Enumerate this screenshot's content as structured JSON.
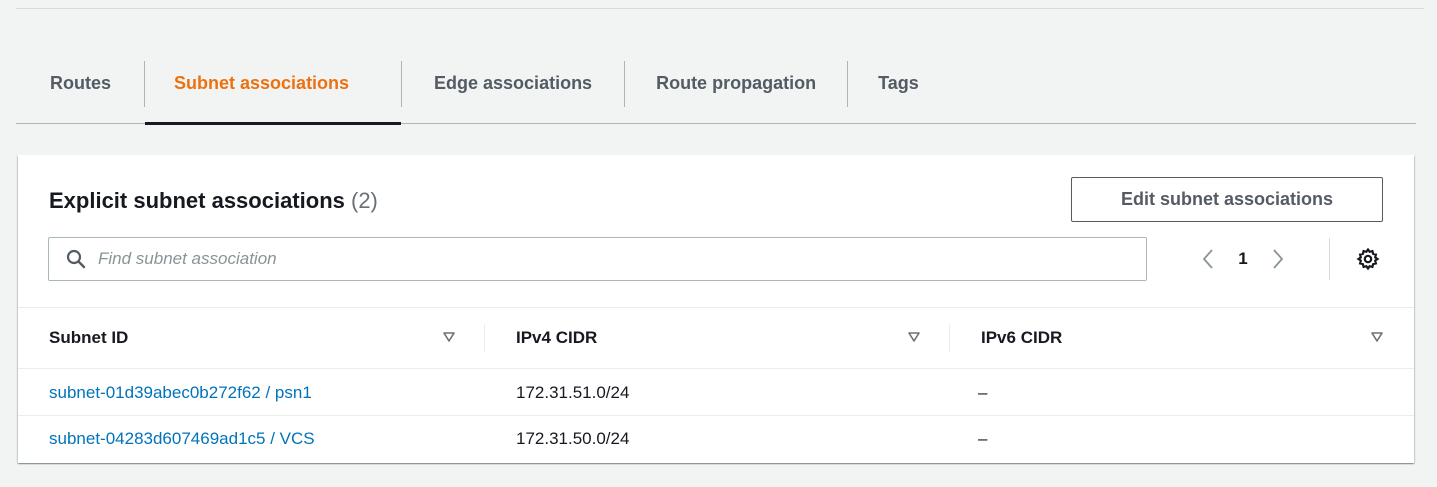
{
  "tabs": [
    {
      "label": "Routes",
      "active": false
    },
    {
      "label": "Subnet associations",
      "active": true
    },
    {
      "label": "Edge associations",
      "active": false
    },
    {
      "label": "Route propagation",
      "active": false
    },
    {
      "label": "Tags",
      "active": false
    }
  ],
  "panel": {
    "title": "Explicit subnet associations",
    "count": "(2)",
    "edit_button": "Edit subnet associations",
    "search_placeholder": "Find subnet association",
    "search_value": "",
    "pagination": {
      "current_page": "1"
    }
  },
  "table": {
    "columns": [
      "Subnet ID",
      "IPv4 CIDR",
      "IPv6 CIDR"
    ],
    "rows": [
      {
        "subnet": "subnet-01d39abec0b272f62 / psn1",
        "ipv4": "172.31.51.0/24",
        "ipv6": "–"
      },
      {
        "subnet": "subnet-04283d607469ad1c5 / VCS",
        "ipv4": "172.31.50.0/24",
        "ipv6": "–"
      }
    ]
  },
  "colors": {
    "active_tab": "#ec7211",
    "link": "#0073bb",
    "text": "#16191f",
    "muted": "#545b64",
    "background": "#f2f3f3"
  },
  "icons": {
    "search": "search-icon",
    "prev": "chevron-left-icon",
    "next": "chevron-right-icon",
    "settings": "gear-icon",
    "sort": "sort-caret-icon"
  }
}
